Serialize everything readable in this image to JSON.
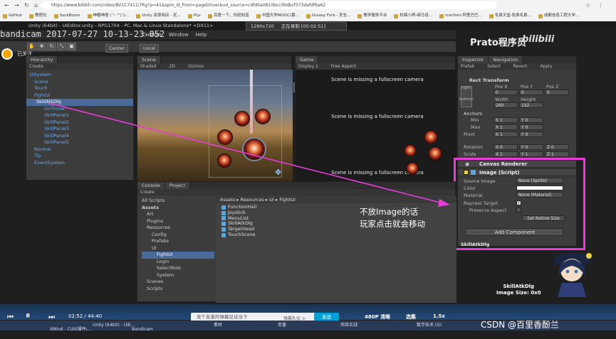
{
  "browser": {
    "url": "https://www.bilibili.com/video/BV1C7411i7Rg?p=41&spm_id_from=pageDriver&vd_source=cdfd0a0810bcc0bdbcf373dafdf6a62",
    "bookmarks": [
      "GitHub",
      "教程化",
      "SockBoom",
      "神樱神億 ( \"- \"')つ...",
      "Unity 资源商店 - 优...",
      "Plyr",
      "百度一下，你就知道",
      "中国大学MOOC(慕...",
      "Greasy Fork - 安全...",
      "教学服务平台",
      "秋裤小熊-绵马母...",
      "iconfont-阿里巴巴...",
      "毛泉天堂-免费毛泉...",
      "成都信息工程大学..."
    ]
  },
  "recording": {
    "title": "Unity (64bit) - UIEditor.unity - RPG1704 - PC, Mac & Linux Standalone* <DX11>",
    "watermark": "bandicam 2017-07-27 10-13-23-052",
    "resolution": "1280x720",
    "status": "正在录制 [00:02:51]"
  },
  "uploader": {
    "follow": "已关注",
    "name": "Prato程序员",
    "site": "bilibili"
  },
  "menu": [
    "Custom",
    "Window",
    "Help"
  ],
  "toolbar": {
    "center": "Center",
    "local": "Local"
  },
  "hierarchy": {
    "tab": "Hierarchy",
    "create": "Create",
    "items": [
      "UISystem",
      "Scene",
      "Touch",
      "FightUI",
      "SkillAtkDlg",
      "UnThrow",
      "SkillPanel1",
      "SkillPanel2",
      "SkillPanel3",
      "SkillPanel4",
      "SkillPanel5",
      "Normal",
      "Tip",
      "EventSystem"
    ]
  },
  "scene": {
    "tab": "Scene",
    "shaded": "Shaded",
    "mode": "2D",
    "gizmos": "Gizmos"
  },
  "game": {
    "tab": "Game",
    "display": "Display 1",
    "aspect": "Free Aspect",
    "missing": "Scene is missing a fullscreen camera"
  },
  "inspector": {
    "tab": "Inspector",
    "tab2": "Navigation",
    "prefab": "Prefab",
    "select": "Select",
    "revert": "Revert",
    "apply": "Apply",
    "rect_transform": "Rect Transform",
    "stretch_h": "right",
    "stretch_v": "bottom",
    "pos_labels": [
      "Pos X",
      "Pos Y",
      "Pos Z"
    ],
    "pos_values": [
      "0",
      "0",
      "0"
    ],
    "width_label": "Width",
    "height_label": "Height",
    "width": "260",
    "height": "192",
    "anchors": "Anchors",
    "min": "Min",
    "max": "Max",
    "pivot": "Pivot",
    "min_x": "X 1",
    "min_y": "Y 0",
    "max_x": "X 1",
    "max_y": "Y 0",
    "pivot_x": "X 1",
    "pivot_y": "Y 0",
    "rotation": "Rotation",
    "rot_x": "X 0",
    "rot_y": "Y 0",
    "rot_z": "Z 0",
    "scale": "Scale",
    "scale_x": "X 1",
    "scale_y": "Y 1",
    "scale_z": "Z 1",
    "canvas_renderer": "Canvas Renderer",
    "image_script": "Image (Script)",
    "source_image": "Source Image",
    "source_value": "None (Sprite)",
    "color": "Color",
    "material": "Material",
    "material_value": "None (Material)",
    "raycast": "Raycast Target",
    "preserve": "Preserve Aspect",
    "set_native": "Set Native Size",
    "add_component": "Add Component",
    "object_name": "SkillAtkDlg"
  },
  "console": {
    "tab": "Console",
    "tab2": "Project",
    "create": "Create"
  },
  "project": {
    "tree": [
      "All Scripts",
      "Assets",
      "Art",
      "Plugins",
      "Resources",
      "Config",
      "Prefabs",
      "UI",
      "FightUI",
      "Login",
      "SelectRole",
      "System",
      "Scenes",
      "Scripts"
    ],
    "breadcrumb": "Assets ▸ Resources ▸ UI ▸ FightUI",
    "files": [
      "FunctionHall",
      "Joystick",
      "MenuList",
      "SkillAtkDlg",
      "TargetHead",
      "TouchScene"
    ]
  },
  "annotation": {
    "line1": "不放Image的话",
    "line2": "玩家点击就会移动"
  },
  "preview": {
    "name": "SkillAtkDlg",
    "size": "Image Size: 0x0"
  },
  "player": {
    "time": "02:52 / 44:40",
    "danmu_placeholder": "发个友善的弹幕见证当下",
    "send": "发送",
    "quality": "480P 清晰",
    "select": "选集",
    "speed": "1.5x",
    "etiquette": "弹幕礼仪 >"
  },
  "taskbar": [
    "Unity (64bit) - UIE...",
    "素材",
    "变量",
    "项目实战",
    "数学技术 (G)",
    "XMind - C\\00课件\\...",
    "Bandicam"
  ],
  "watermark": "CSDN @百里香酚兰",
  "colors": {
    "highlight": "#e83cd9",
    "arrow": "#e83cd9",
    "unity_bg": "#3c3c3c",
    "selection": "#4a6a9a",
    "bili_blue": "#00a1d6"
  }
}
